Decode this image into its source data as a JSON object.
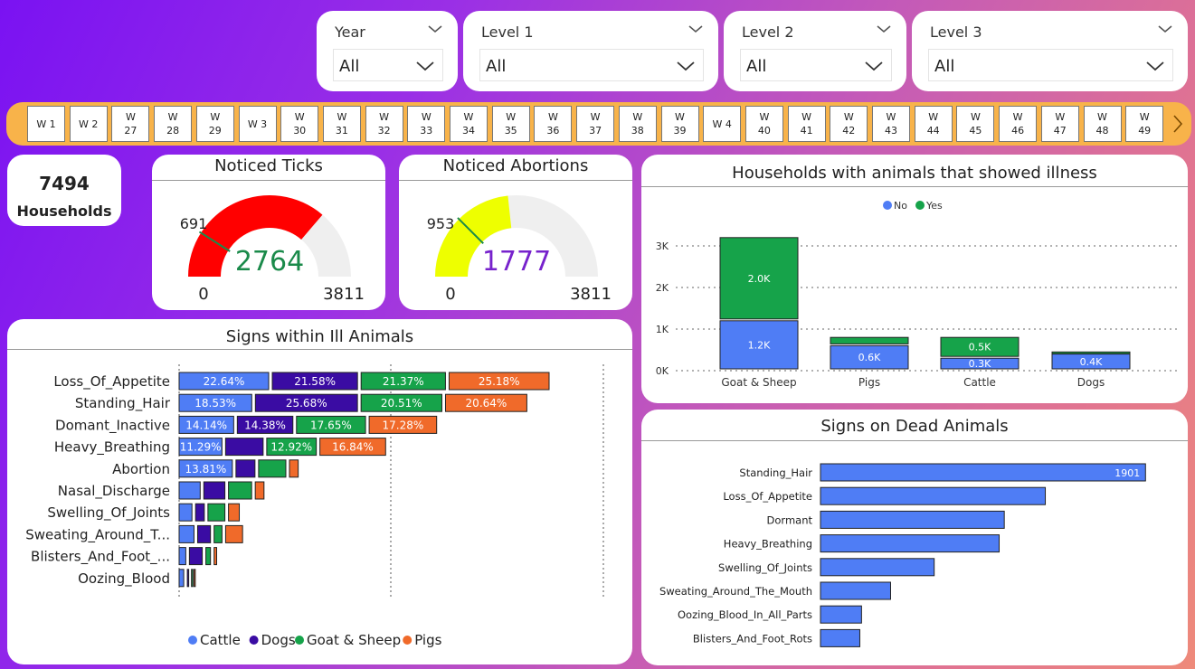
{
  "slicers": [
    {
      "label": "Year",
      "value": "All"
    },
    {
      "label": "Level 1",
      "value": "All"
    },
    {
      "label": "Level 2",
      "value": "All"
    },
    {
      "label": "Level 3",
      "value": "All"
    }
  ],
  "weeks": [
    "W 1",
    "W 2",
    "W\n27",
    "W\n28",
    "W\n29",
    "W 3",
    "W\n30",
    "W\n31",
    "W\n32",
    "W\n33",
    "W\n34",
    "W\n35",
    "W\n36",
    "W\n37",
    "W\n38",
    "W\n39",
    "W 4",
    "W\n40",
    "W\n41",
    "W\n42",
    "W\n43",
    "W\n44",
    "W\n45",
    "W\n46",
    "W\n47",
    "W\n48",
    "W\n49"
  ],
  "kpi": {
    "value": "7494",
    "label": "Households"
  },
  "gauges": [
    {
      "title": "Noticed Ticks",
      "value": "2764",
      "min": "0",
      "max": "3811",
      "target": "691",
      "fill_fraction": 0.725,
      "target_fraction": 0.181,
      "color": "#ff0000",
      "value_color": "#1a8a4a"
    },
    {
      "title": "Noticed Abortions",
      "value": "1777",
      "min": "0",
      "max": "3811",
      "target": "953",
      "fill_fraction": 0.466,
      "target_fraction": 0.25,
      "color": "#eeff00",
      "value_color": "#7722cc"
    }
  ],
  "illness": {
    "title": "Households with animals that showed illness",
    "legend": [
      {
        "name": "No",
        "color": "#4f7df5"
      },
      {
        "name": "Yes",
        "color": "#16a34a"
      }
    ],
    "yticks": [
      "0K",
      "1K",
      "2K",
      "3K"
    ],
    "chart_data": {
      "type": "bar",
      "stacked": true,
      "categories": [
        "Goat & Sheep",
        "Pigs",
        "Cattle",
        "Dogs"
      ],
      "series": [
        {
          "name": "No",
          "values": [
            1.2,
            0.6,
            0.3,
            0.4
          ],
          "labels": [
            "1.2K",
            "0.6K",
            "0.3K",
            "0.4K"
          ]
        },
        {
          "name": "Yes",
          "values": [
            2.0,
            0.2,
            0.5,
            0.05
          ],
          "labels": [
            "2.0K",
            "",
            "0.5K",
            ""
          ]
        }
      ],
      "ylim": [
        0,
        3.2
      ]
    }
  },
  "signs": {
    "title": "Signs within Ill Animals",
    "legend": [
      {
        "name": "Cattle",
        "color": "#4f7df5"
      },
      {
        "name": "Dogs",
        "color": "#3a0ca3"
      },
      {
        "name": "Goat & Sheep",
        "color": "#16a34a"
      },
      {
        "name": "Pigs",
        "color": "#f06a2a"
      }
    ],
    "chart_data": {
      "type": "bar",
      "orientation": "horizontal",
      "stacked": true,
      "categories": [
        "Loss_Of_Appetite",
        "Standing_Hair",
        "Domant_Inactive",
        "Heavy_Breathing",
        "Abortion",
        "Nasal_Discharge",
        "Swelling_Of_Joints",
        "Sweating_Around_T...",
        "Blisters_And_Foot_...",
        "Oozing_Blood"
      ],
      "series": [
        {
          "name": "Cattle",
          "values": [
            22.64,
            18.53,
            14.14,
            11.29,
            13.81,
            6.0,
            4.0,
            4.5,
            2.5,
            2.0
          ],
          "labels": [
            "22.64%",
            "18.53%",
            "14.14%",
            "11.29%",
            "13.81%",
            "",
            "",
            "",
            "",
            ""
          ]
        },
        {
          "name": "Dogs",
          "values": [
            21.58,
            25.68,
            14.38,
            10.0,
            5.5,
            6.0,
            3.0,
            4.0,
            4.0,
            1.0
          ],
          "labels": [
            "21.58%",
            "25.68%",
            "14.38%",
            "",
            "",
            "",
            "",
            "",
            "",
            ""
          ]
        },
        {
          "name": "Goat & Sheep",
          "values": [
            21.37,
            20.51,
            17.65,
            12.92,
            7.5,
            6.5,
            5.0,
            2.8,
            2.0,
            0.6
          ],
          "labels": [
            "21.37%",
            "20.51%",
            "17.65%",
            "12.92%",
            "",
            "",
            "",
            "",
            "",
            ""
          ]
        },
        {
          "name": "Pigs",
          "values": [
            25.18,
            20.64,
            17.28,
            16.84,
            3.0,
            3.0,
            3.5,
            5.0,
            1.5,
            0.5
          ],
          "labels": [
            "25.18%",
            "20.64%",
            "17.28%",
            "16.84%",
            "",
            "",
            "",
            "",
            "",
            ""
          ]
        }
      ]
    }
  },
  "dead": {
    "title": "Signs on Dead Animals",
    "chart_data": {
      "type": "bar",
      "orientation": "horizontal",
      "categories": [
        "Standing_Hair",
        "Loss_Of_Appetite",
        "Dormant",
        "Heavy_Breathing",
        "Swelling_Of_Joints",
        "Sweating_Around_The_Mouth",
        "Oozing_Blood_In_All_Parts",
        "Blisters_And_Foot_Rots"
      ],
      "values": [
        1901,
        1315,
        1075,
        1045,
        665,
        410,
        240,
        230
      ],
      "labels": [
        "1901",
        "",
        "",
        "",
        "",
        "",
        "",
        ""
      ],
      "color": "#4f7df5"
    }
  }
}
